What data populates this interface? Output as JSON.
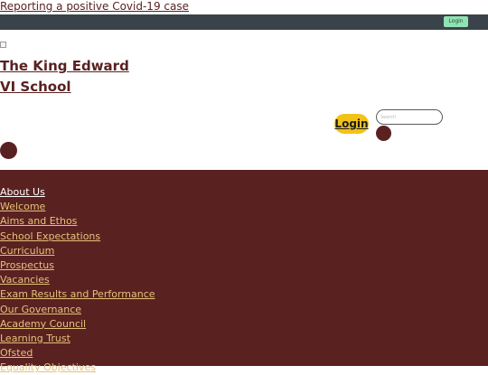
{
  "alert": {
    "text": " Reporting a positive Covid-19 case"
  },
  "util_bar": {
    "login_label": "Login"
  },
  "header": {
    "school_name_line1": "The King Edward",
    "school_name_line2": "VI School",
    "login_label": "Login",
    "search_placeholder": "Search"
  },
  "nav": {
    "section_label": "About Us",
    "items": [
      "Welcome",
      "Aims and Ethos",
      "School Expectations",
      "Curriculum",
      "Prospectus",
      "Vacancies",
      "Exam Results and Performance",
      "Our Governance",
      "Academy Council",
      "Learning Trust",
      "Ofsted",
      "Equality Objectives"
    ]
  },
  "colors": {
    "brand_maroon": "#5a2121",
    "util_bar": "#3a434a",
    "login_yellow": "#f2c21b",
    "util_login_green": "#8fe3b2",
    "nav_link": "#e4c27a"
  }
}
